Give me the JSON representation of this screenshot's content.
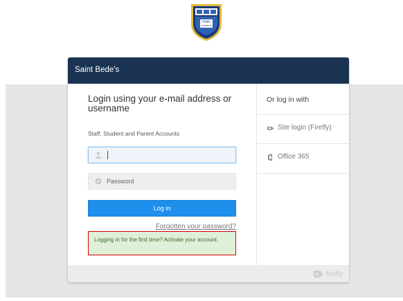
{
  "crest": {
    "icon": "school-crest-icon",
    "text_line1": "POMS",
    "text_line2": "SAPIENTIA",
    "colors": {
      "navy": "#1a3a7a",
      "gold": "#e3b93a",
      "blue": "#2f63b5"
    }
  },
  "header": {
    "school_name": "Saint Bede's"
  },
  "login": {
    "heading": "Login using your e-mail address or username",
    "subheading": "Staff, Student and Parent Accounts",
    "username_placeholder": "",
    "username_value": "",
    "password_placeholder": "Password",
    "button_label": "Log in",
    "forgot_link": "Forgotten your password?",
    "first_time_text": "Logging in for the first time? Activate your account."
  },
  "alternatives": {
    "title": "Or log in with",
    "providers": [
      {
        "label": "Site login (Firefly)",
        "icon": "firefly-icon"
      },
      {
        "label": "Office 365",
        "icon": "office-icon"
      }
    ]
  },
  "footer": {
    "brand": "firefly",
    "brand_icon": "firefly-logo-icon"
  },
  "colors": {
    "header_bg": "#1a3353",
    "button_bg": "#1e90ec",
    "notice_bg": "#dff0d8",
    "notice_border": "#d00000",
    "page_band": "#e6e6e6"
  }
}
